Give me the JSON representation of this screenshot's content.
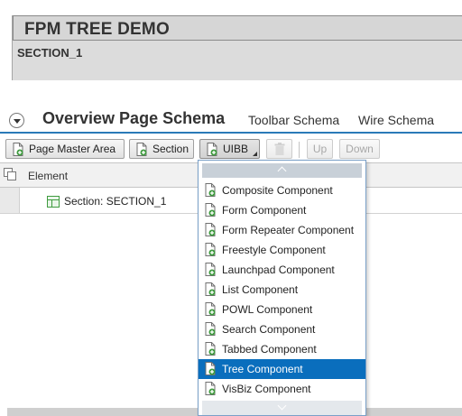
{
  "app": {
    "title": "FPM TREE DEMO",
    "section": "SECTION_1"
  },
  "tabs": {
    "active": "Overview Page Schema",
    "items": [
      "Toolbar Schema",
      "Wire Schema"
    ]
  },
  "toolbar": {
    "page_master_area": "Page Master Area",
    "section": "Section",
    "uibb": "UIBB",
    "delete_icon": "trash-icon",
    "up": "Up",
    "down": "Down"
  },
  "tree": {
    "column_element": "Element",
    "row_label": "Section: SECTION_1"
  },
  "dropdown": {
    "items": [
      "Composite Component",
      "Form Component",
      "Form Repeater Component",
      "Freestyle Component",
      "Launchpad Component",
      "List Component",
      "POWL Component",
      "Search Component",
      "Tabbed Component",
      "Tree Component",
      "VisBiz Component"
    ],
    "selected_index": 9
  },
  "colors": {
    "accent": "#2a7ab8",
    "selection": "#0a6ebd",
    "add_icon": "#3f9b3f"
  }
}
